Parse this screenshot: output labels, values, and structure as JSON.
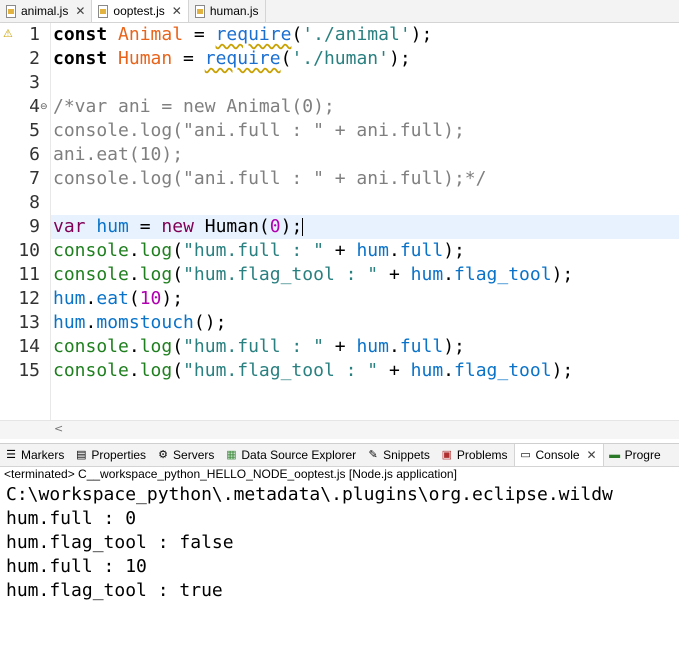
{
  "editor_tabs": [
    {
      "label": "animal.js",
      "active": false,
      "closable": true
    },
    {
      "label": "ooptest.js",
      "active": true,
      "closable": true
    },
    {
      "label": "human.js",
      "active": false,
      "closable": false
    }
  ],
  "code_lines": [
    {
      "n": "1",
      "text": "const Animal = require('./animal');"
    },
    {
      "n": "2",
      "text": "const Human = require('./human');"
    },
    {
      "n": "3",
      "text": ""
    },
    {
      "n": "4",
      "text": "/*var ani = new Animal(0);"
    },
    {
      "n": "5",
      "text": "console.log(\"ani.full : \" + ani.full);"
    },
    {
      "n": "6",
      "text": "ani.eat(10);"
    },
    {
      "n": "7",
      "text": "console.log(\"ani.full : \" + ani.full);*/"
    },
    {
      "n": "8",
      "text": ""
    },
    {
      "n": "9",
      "text": "var hum = new Human(0);"
    },
    {
      "n": "10",
      "text": "console.log(\"hum.full : \" + hum.full);"
    },
    {
      "n": "11",
      "text": "console.log(\"hum.flag_tool : \" + hum.flag_tool);"
    },
    {
      "n": "12",
      "text": "hum.eat(10);"
    },
    {
      "n": "13",
      "text": "hum.momstouch();"
    },
    {
      "n": "14",
      "text": "console.log(\"hum.full : \" + hum.full);"
    },
    {
      "n": "15",
      "text": "console.log(\"hum.flag_tool : \" + hum.flag_tool);"
    }
  ],
  "panel_tabs": [
    {
      "label": "Markers",
      "icon": "markers-icon",
      "active": false
    },
    {
      "label": "Properties",
      "icon": "properties-icon",
      "active": false
    },
    {
      "label": "Servers",
      "icon": "servers-icon",
      "active": false
    },
    {
      "label": "Data Source Explorer",
      "icon": "data-source-icon",
      "active": false
    },
    {
      "label": "Snippets",
      "icon": "snippets-icon",
      "active": false
    },
    {
      "label": "Problems",
      "icon": "problems-icon",
      "active": false
    },
    {
      "label": "Console",
      "icon": "console-icon",
      "active": true
    },
    {
      "label": "Progre",
      "icon": "progress-icon",
      "active": false
    }
  ],
  "console_status": "<terminated> C__workspace_python_HELLO_NODE_ooptest.js [Node.js application]",
  "console_output": [
    "C:\\workspace_python\\.metadata\\.plugins\\org.eclipse.wildw",
    "hum.full : 0",
    "hum.flag_tool : false",
    "hum.full : 10",
    "hum.flag_tool : true"
  ]
}
